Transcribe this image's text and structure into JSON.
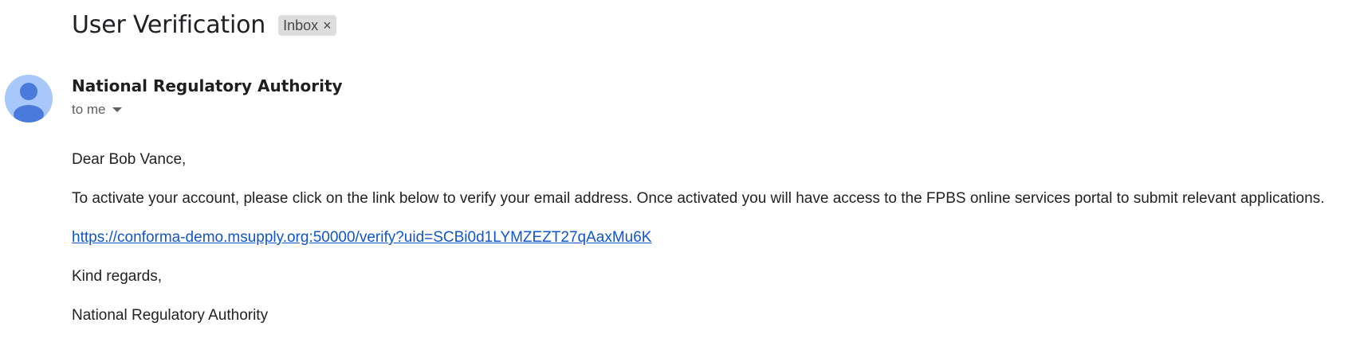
{
  "email": {
    "subject": "User Verification",
    "label_chip": {
      "label": "Inbox",
      "close_glyph": "×"
    },
    "sender": {
      "name": "National Regulatory Authority",
      "avatar_icon": "person-icon",
      "avatar_bg": "#a8c7fa",
      "avatar_fg": "#4a7adb"
    },
    "recipient": {
      "text": "to me",
      "icon": "chevron-down-icon"
    },
    "body": {
      "greeting": "Dear Bob Vance,",
      "message": "To activate your account, please click on the link below to verify your email address. Once activated you will have access to the FPBS online services portal to submit relevant applications.",
      "link": "https://conforma-demo.msupply.org:50000/verify?uid=SCBi0d1LYMZEZT27qAaxMu6K",
      "closing": "Kind regards,",
      "signature": "National Regulatory Authority"
    },
    "colors": {
      "link": "#1155cc",
      "chip_bg": "#dddddd"
    }
  }
}
